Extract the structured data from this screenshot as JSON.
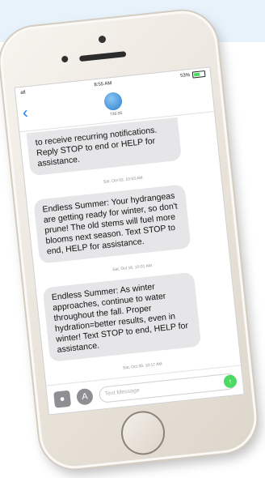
{
  "status_bar": {
    "carrier": "atl",
    "time": "8:55 AM",
    "battery": "53%"
  },
  "nav": {
    "contact": "736-95"
  },
  "messages": [
    {
      "type": "bubble",
      "text": "to receive recurring notifications. Reply STOP to end or HELP for assistance."
    },
    {
      "type": "timestamp",
      "text": "Sat, Oct 02, 10:03 AM"
    },
    {
      "type": "bubble",
      "text": "Endless Summer: Your hydrangeas are getting ready for winter, so don't prune! The old stems will fuel more blooms next season. Text STOP to end, HELP for assistance."
    },
    {
      "type": "timestamp",
      "text": "Sat, Oct 16, 10:01 AM"
    },
    {
      "type": "bubble",
      "text": "Endless Summer: As winter approaches, continue to water throughout the fall. Proper hydration=better results, even in winter! Text STOP to end, HELP for assistance."
    },
    {
      "type": "timestamp",
      "text": "Sat, Oct 30, 10:17 AM"
    }
  ],
  "input": {
    "placeholder": "Text Message"
  },
  "icons": {
    "camera": "camera-icon",
    "apps": "app-store-icon",
    "mic": "microphone-icon",
    "back": "chevron-left-icon"
  },
  "colors": {
    "accent": "#1a7cf5",
    "bubble": "#e6e6e8",
    "mic": "#4cd964",
    "band": "#e8f2fa"
  }
}
